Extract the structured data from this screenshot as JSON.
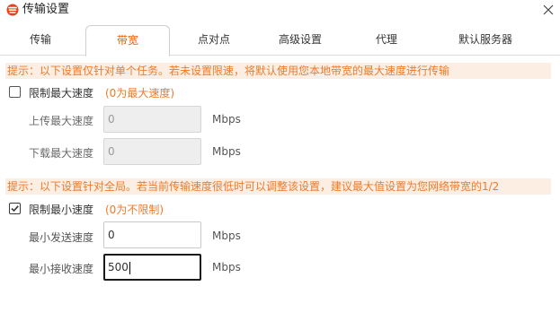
{
  "window": {
    "title": "传输设置",
    "logo_icon": "app-logo-icon",
    "close_icon": "close-icon"
  },
  "tabs": [
    {
      "label": "传输",
      "active": false
    },
    {
      "label": "带宽",
      "active": true
    },
    {
      "label": "点对点",
      "active": false
    },
    {
      "label": "高级设置",
      "active": false
    },
    {
      "label": "代理",
      "active": false
    },
    {
      "label": "默认服务器",
      "active": false
    }
  ],
  "section_max": {
    "hint": "提示：以下设置仅针对单个任务。若未设置限速，将默认使用您本地带宽的最大速度进行传输",
    "checkbox_label": "限制最大速度",
    "checkbox_note": "(0为最大速度)",
    "checked": false,
    "upload_label": "上传最大速度",
    "upload_value": "0",
    "download_label": "下载最大速度",
    "download_value": "0",
    "unit": "Mbps"
  },
  "section_min": {
    "hint": "提示：以下设置针对全局。若当前传输速度很低时可以调整该设置，建议最大值设置为您网络带宽的1/2",
    "checkbox_label": "限制最小速度",
    "checkbox_note": "(0为不限制)",
    "checked": true,
    "send_label": "最小发送速度",
    "send_value": "0",
    "receive_label": "最小接收速度",
    "receive_value": "500",
    "unit": "Mbps"
  },
  "colors": {
    "accent": "#f25c05",
    "hint_text": "#ee7a28",
    "hint_bg": "#fdeee4"
  }
}
